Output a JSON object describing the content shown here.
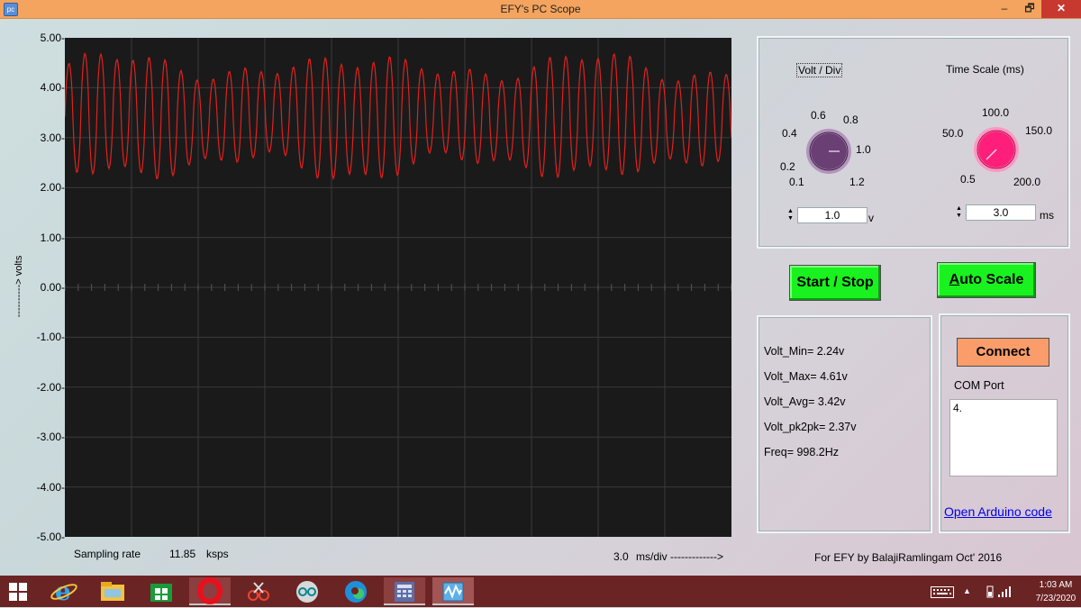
{
  "window": {
    "title": "EFY's PC Scope",
    "minimize": "–",
    "maximize": "🗗",
    "close": "✕",
    "app_icon": "pc"
  },
  "scope": {
    "y_axis_label": "----------> volts",
    "y_ticks": [
      "5.00-",
      "4.00-",
      "3.00-",
      "2.00-",
      "1.00-",
      "0.00-",
      "-1.00-",
      "-2.00-",
      "-3.00-",
      "-4.00-",
      "-5.00-"
    ],
    "sampling_label": "Sampling rate",
    "sampling_value": "11.85",
    "sampling_unit": "ksps",
    "timebase_value": "3.0",
    "timebase_label": "ms/div ------------->",
    "trace_color": "#e0211f",
    "background_color": "#1a1a1a"
  },
  "controls": {
    "volt_div": {
      "title": "Volt / Div",
      "ticks": [
        "0.1",
        "0.2",
        "0.4",
        "0.6",
        "0.8",
        "1.0",
        "1.2"
      ],
      "value": "1.0",
      "unit": "v",
      "knob_color": "#6a3f74"
    },
    "time_scale": {
      "title": "Time Scale (ms)",
      "ticks": [
        "0.5",
        "50.0",
        "100.0",
        "150.0",
        "200.0"
      ],
      "value": "3.0",
      "unit": "ms",
      "knob_color": "#ff1f7a"
    }
  },
  "buttons": {
    "start_stop": "Start / Stop",
    "auto_scale_first": "A",
    "auto_scale_rest": "uto Scale",
    "connect": "Connect"
  },
  "stats": {
    "volt_min": "Volt_Min= 2.24v",
    "volt_max": "Volt_Max= 4.61v",
    "volt_avg": "Volt_Avg= 3.42v",
    "volt_pk2pk": "Volt_pk2pk= 2.37v",
    "freq": "Freq= 998.2Hz"
  },
  "com": {
    "label": "COM Port",
    "ports": [
      "4."
    ],
    "link": "Open Arduino code"
  },
  "credit": "For EFY by BalajiRamlingam Oct' 2016",
  "taskbar": {
    "apps": [
      "start-icon",
      "ie-icon",
      "file-explorer-icon",
      "store-icon",
      "opera-icon",
      "snipping-tool-icon",
      "arduino-icon",
      "edge-icon",
      "calculator-icon",
      "pc-scope-icon"
    ],
    "time": "1:03 AM",
    "date": "7/23/2020"
  }
}
